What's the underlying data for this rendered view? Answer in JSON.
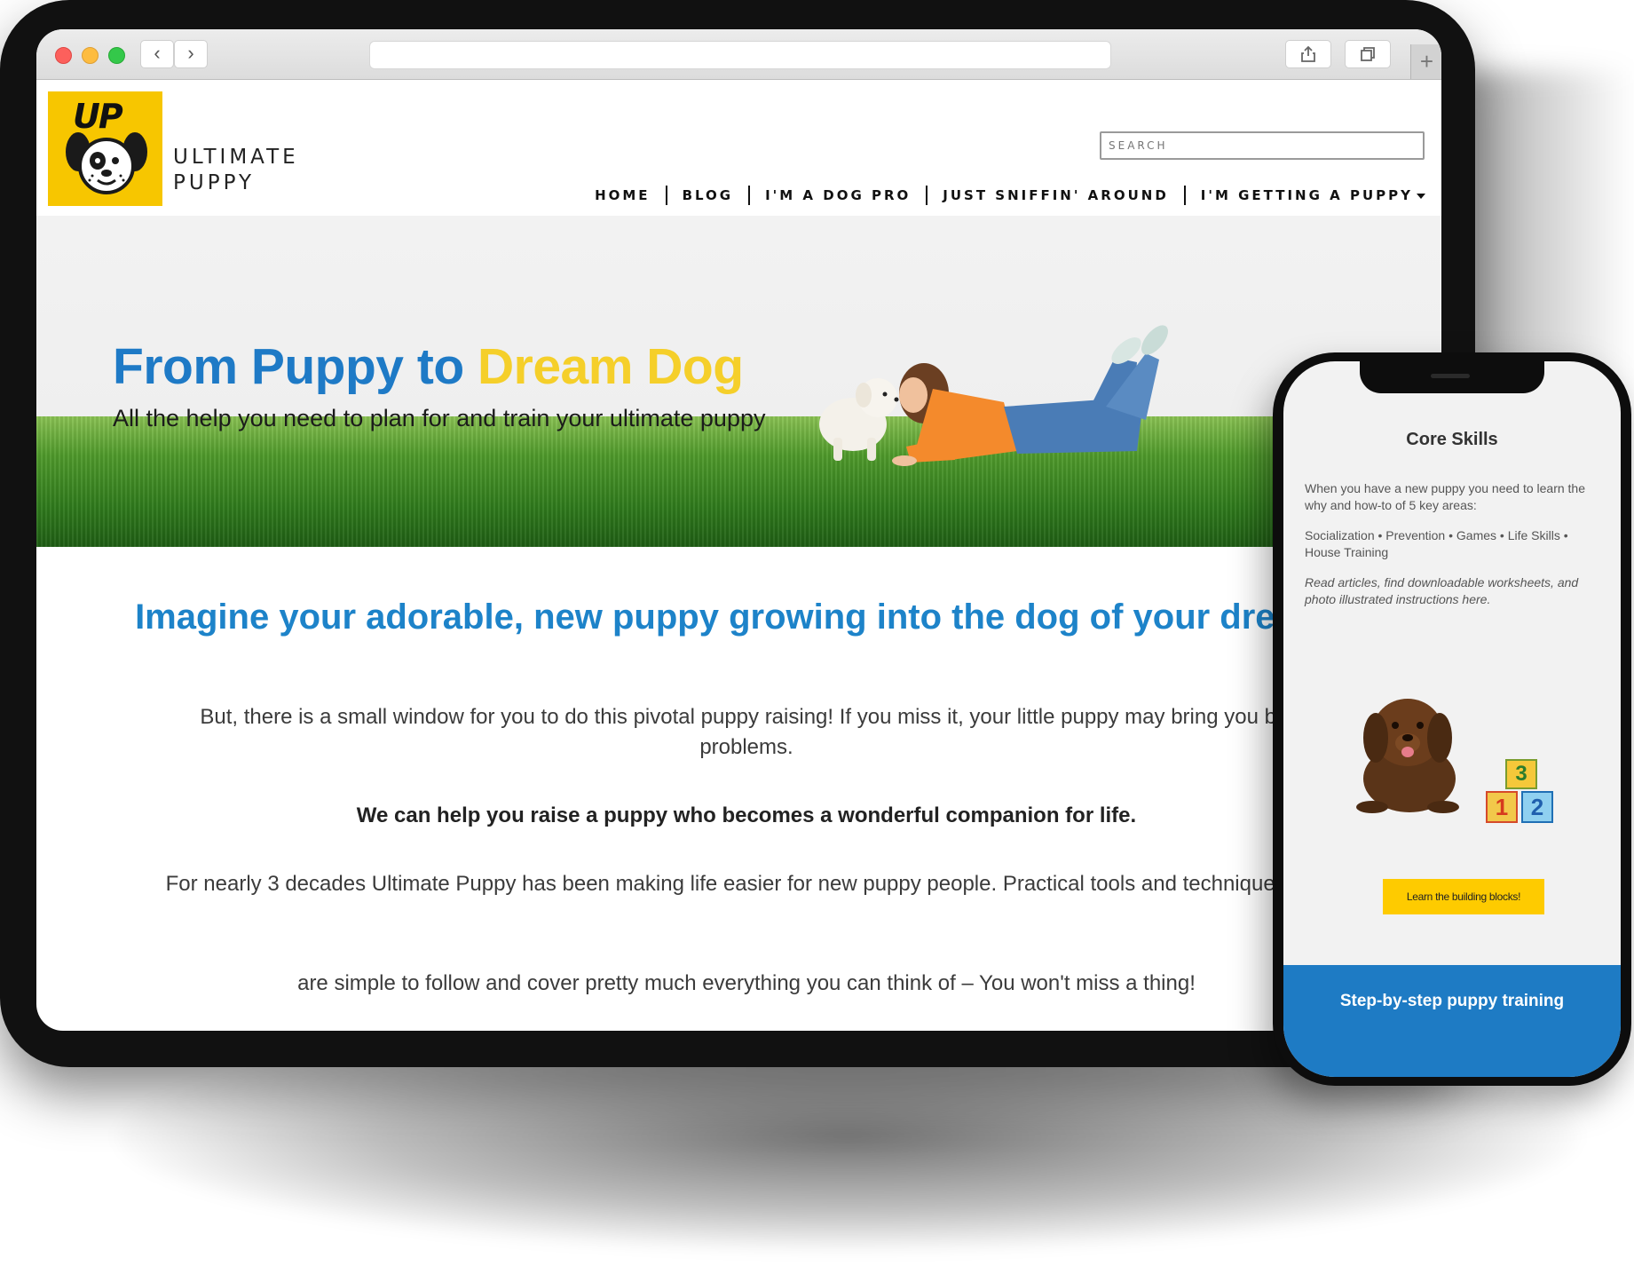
{
  "browser": {
    "back_icon": "‹",
    "forward_icon": "›",
    "share_icon": "share-icon",
    "tabs_icon": "tabs-icon",
    "new_tab_icon": "+"
  },
  "site": {
    "logo_text": "UP",
    "brand_line1": "ULTIMATE",
    "brand_line2": "PUPPY",
    "search_placeholder": "SEARCH",
    "nav": {
      "home": "HOME",
      "blog": "BLOG",
      "dog_pro": "I'M A DOG PRO",
      "sniffin": "JUST SNIFFIN' AROUND",
      "getting_puppy": "I'M GETTING A PUPPY"
    }
  },
  "hero": {
    "title_part1": "From Puppy to ",
    "title_part2": "Dream Dog",
    "subtitle": "All the help you need to plan for and train your ultimate puppy"
  },
  "main": {
    "headline": "Imagine your adorable, new puppy growing into the dog of your dreams!",
    "para1": "But, there is a small window for you to do this pivotal puppy raising! If you miss it, your little puppy may bring you big problems.",
    "para2": "We can help you raise a puppy who becomes a wonderful companion for life.",
    "para3": "For nearly 3 decades Ultimate Puppy has been making life easier for new puppy people. Practical tools and techniques that",
    "para4": "are simple to follow and cover pretty much everything you can think of – You won't miss a thing!"
  },
  "phone": {
    "title": "Core Skills",
    "intro": "When you have a new puppy you need to learn the why and how-to of 5 key areas:",
    "areas": "Socialization • Prevention • Games • Life Skills • House Training",
    "note": "Read articles, find downloadable worksheets, and photo illustrated instructions here.",
    "block_numbers": [
      "3",
      "1",
      "2"
    ],
    "button": "Learn the building blocks!",
    "band": "Step-by-step puppy training"
  },
  "colors": {
    "brand_blue": "#1e7ac6",
    "brand_yellow": "#f5cf2a",
    "button_yellow": "#fecb00",
    "band_blue": "#1e7bc4"
  }
}
